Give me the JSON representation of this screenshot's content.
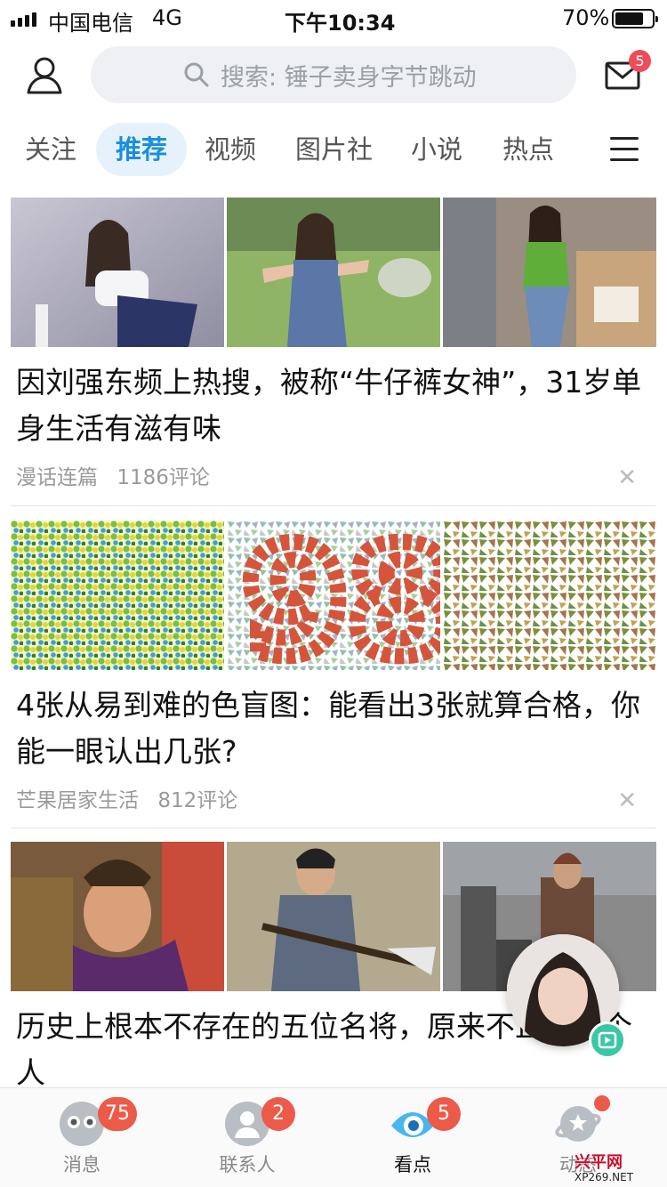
{
  "status_bar": {
    "carrier": "中国电信",
    "network": "4G",
    "time": "下午10:34",
    "battery": "70%",
    "battery_level": 0.7
  },
  "top_bar": {
    "search_placeholder": "搜索: 锤子卖身字节跳动",
    "mail_badge": "5"
  },
  "tabs": [
    {
      "label": "关注",
      "active": false
    },
    {
      "label": "推荐",
      "active": true
    },
    {
      "label": "视频",
      "active": false
    },
    {
      "label": "图片社",
      "active": false
    },
    {
      "label": "小说",
      "active": false
    },
    {
      "label": "热点",
      "active": false
    }
  ],
  "articles": [
    {
      "title": "因刘强东频上热搜，被称“牛仔裤女神”，31岁单身生活有滋有味",
      "source": "漫话连篇",
      "comments": "1186评论"
    },
    {
      "title": "4张从易到难的色盲图：能看出3张就算合格，你能一眼认出几张?",
      "source": "芒果居家生活",
      "comments": "812评论"
    },
    {
      "title": "历史上根本不存在的五位名将，原来不止我一个人"
    }
  ],
  "close_symbol": "✕",
  "bottom_nav": [
    {
      "label": "消息",
      "badge": "75",
      "active": false,
      "icon": "chat-ghost-icon"
    },
    {
      "label": "联系人",
      "badge": "2",
      "active": false,
      "icon": "contact-icon"
    },
    {
      "label": "看点",
      "badge": "5",
      "active": true,
      "icon": "eye-icon"
    },
    {
      "label": "动态",
      "badge": "",
      "active": false,
      "icon": "planet-icon"
    }
  ],
  "watermark": {
    "name": "兴平网",
    "url": "XP269.NET"
  },
  "colors": {
    "accent": "#1b8fdc",
    "badge": "#ec5a4a",
    "search_bg": "#eef0f3",
    "play": "#3cc6a8"
  }
}
